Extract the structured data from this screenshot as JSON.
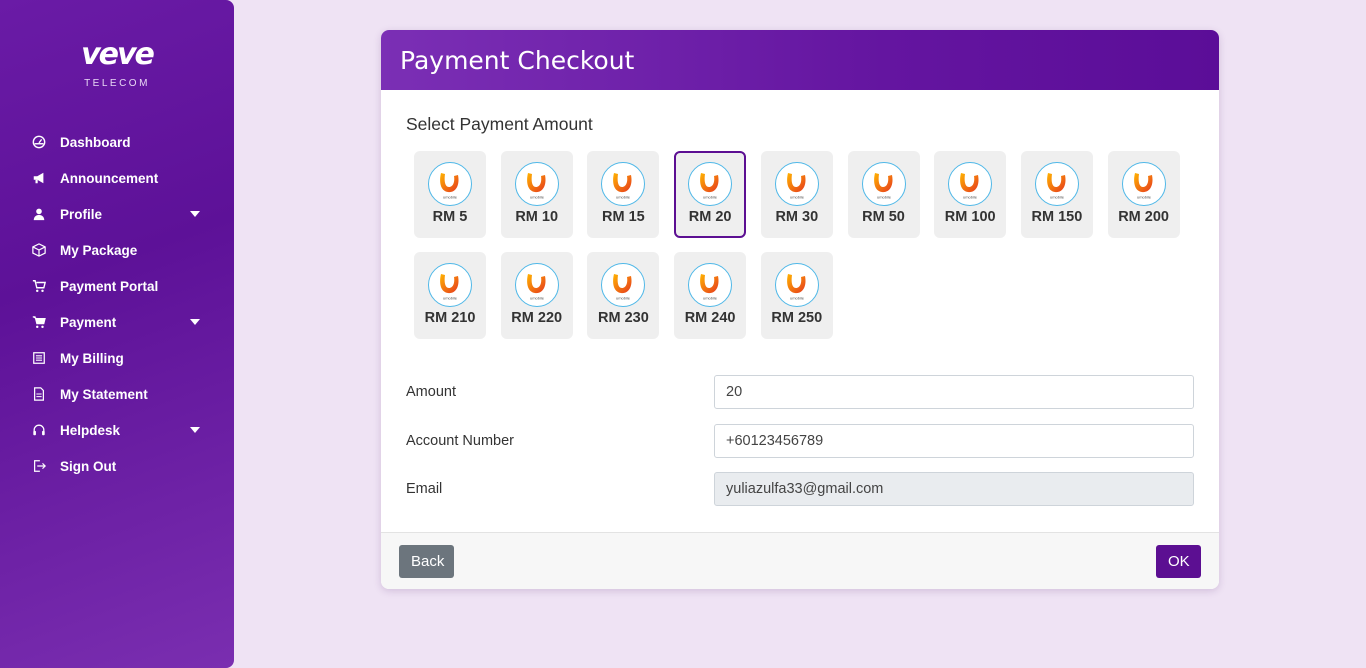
{
  "brand": {
    "name": "veve",
    "subtitle": "TELECOM"
  },
  "sidebar": {
    "items": [
      {
        "label": "Dashboard",
        "icon": "dashboard-icon",
        "dropdown": false
      },
      {
        "label": "Announcement",
        "icon": "megaphone-icon",
        "dropdown": false
      },
      {
        "label": "Profile",
        "icon": "user-icon",
        "dropdown": true
      },
      {
        "label": "My Package",
        "icon": "package-icon",
        "dropdown": false
      },
      {
        "label": "Payment Portal",
        "icon": "cart-icon",
        "dropdown": false
      },
      {
        "label": "Payment",
        "icon": "cart-icon",
        "dropdown": true
      },
      {
        "label": "My Billing",
        "icon": "billing-icon",
        "dropdown": false
      },
      {
        "label": "My Statement",
        "icon": "document-icon",
        "dropdown": false
      },
      {
        "label": "Helpdesk",
        "icon": "headset-icon",
        "dropdown": true
      },
      {
        "label": "Sign Out",
        "icon": "signout-icon",
        "dropdown": false
      }
    ]
  },
  "checkout": {
    "title": "Payment Checkout",
    "section_title": "Select Payment Amount",
    "selected_amount": "RM 20",
    "amounts": [
      "RM 5",
      "RM 10",
      "RM 15",
      "RM 20",
      "RM 30",
      "RM 50",
      "RM 100",
      "RM 150",
      "RM 200",
      "RM 210",
      "RM 220",
      "RM 230",
      "RM 240",
      "RM 250"
    ],
    "provider_logo_text": "umobile",
    "form": {
      "amount_label": "Amount",
      "amount_value": "20",
      "account_label": "Account Number",
      "account_value": "+60123456789",
      "email_label": "Email",
      "email_value": "yuliazulfa33@gmail.com"
    },
    "back_label": "Back",
    "ok_label": "OK"
  },
  "colors": {
    "accent": "#5c0f92",
    "background": "#efe3f4",
    "sidebar": "#6a1ba6"
  }
}
